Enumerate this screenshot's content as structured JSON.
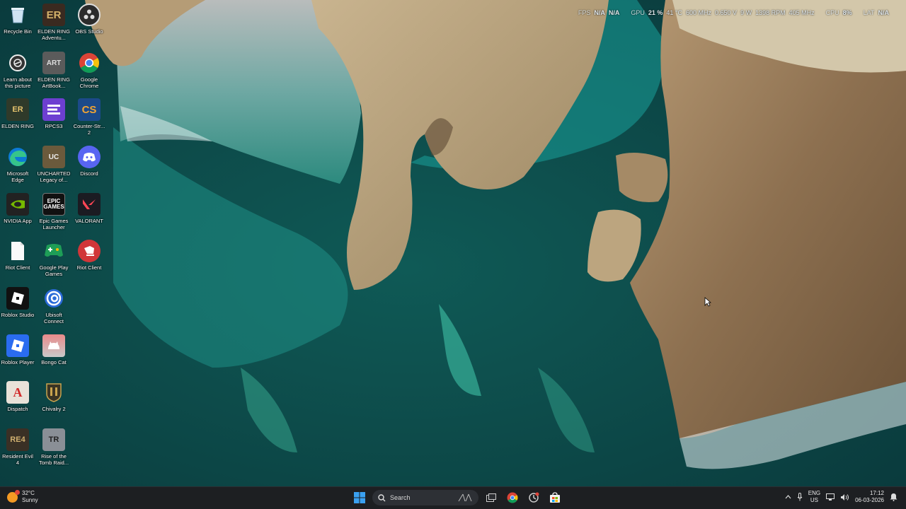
{
  "overlay": {
    "fps_label": "FPS",
    "fps_value1": "N/A",
    "fps_value2": "N/A",
    "gpu_label": "GPU",
    "gpu_load": "21 %",
    "gpu_temp": "41 °C",
    "gpu_clock": "600 MHz",
    "gpu_voltage": "0.650 V",
    "gpu_power": "9 W",
    "gpu_fan": "1398 RPM",
    "gpu_mem": "405 MHz",
    "cpu_label": "CPU",
    "cpu_value": "8%",
    "lat_label": "LAT",
    "lat_value": "N/A"
  },
  "desktop_icons": [
    {
      "label": "Recycle Bin",
      "icon": "recycle-bin-icon"
    },
    {
      "label": "ELDEN RING Adventu...",
      "icon": "elden-ring-adventure-icon"
    },
    {
      "label": "OBS Studio",
      "icon": "obs-studio-icon"
    },
    {
      "label": "Learn about this picture",
      "icon": "learn-about-picture-icon"
    },
    {
      "label": "ELDEN RING ArtBook...",
      "icon": "elden-ring-artbook-icon"
    },
    {
      "label": "Google Chrome",
      "icon": "chrome-icon"
    },
    {
      "label": "ELDEN RING",
      "icon": "elden-ring-icon"
    },
    {
      "label": "RPCS3",
      "icon": "rpcs3-icon"
    },
    {
      "label": "Counter-Str... 2",
      "icon": "counter-strike-icon"
    },
    {
      "label": "Microsoft Edge",
      "icon": "edge-icon"
    },
    {
      "label": "UNCHARTED Legacy of...",
      "icon": "uncharted-icon"
    },
    {
      "label": "Discord",
      "icon": "discord-icon"
    },
    {
      "label": "NVIDIA App",
      "icon": "nvidia-icon"
    },
    {
      "label": "Epic Games Launcher",
      "icon": "epic-games-icon"
    },
    {
      "label": "VALORANT",
      "icon": "valorant-icon"
    },
    {
      "label": "Riot Client",
      "icon": "file-icon"
    },
    {
      "label": "Google Play Games",
      "icon": "google-play-games-icon"
    },
    {
      "label": "Riot Client",
      "icon": "riot-client-icon"
    },
    {
      "label": "Roblox Studio",
      "icon": "roblox-studio-icon"
    },
    {
      "label": "Ubisoft Connect",
      "icon": "ubisoft-connect-icon"
    },
    {
      "label": "Roblox Player",
      "icon": "roblox-player-icon"
    },
    {
      "label": "Bongo Cat",
      "icon": "bongo-cat-icon"
    },
    {
      "label": "Dispatch",
      "icon": "dispatch-icon"
    },
    {
      "label": "Chivalry 2",
      "icon": "chivalry-icon"
    },
    {
      "label": "Resident Evil 4",
      "icon": "resident-evil-icon"
    },
    {
      "label": "Rise of the Tomb Raid...",
      "icon": "tomb-raider-icon"
    }
  ],
  "taskbar": {
    "weather_temp": "32°C",
    "weather_desc": "Sunny",
    "search_placeholder": "Search",
    "lang_line1": "ENG",
    "lang_line2": "US",
    "time": "17:12",
    "date": "06-03-2026"
  },
  "colors": {
    "taskbar_bg": "#1d1f22",
    "accent": "#0078d4"
  }
}
